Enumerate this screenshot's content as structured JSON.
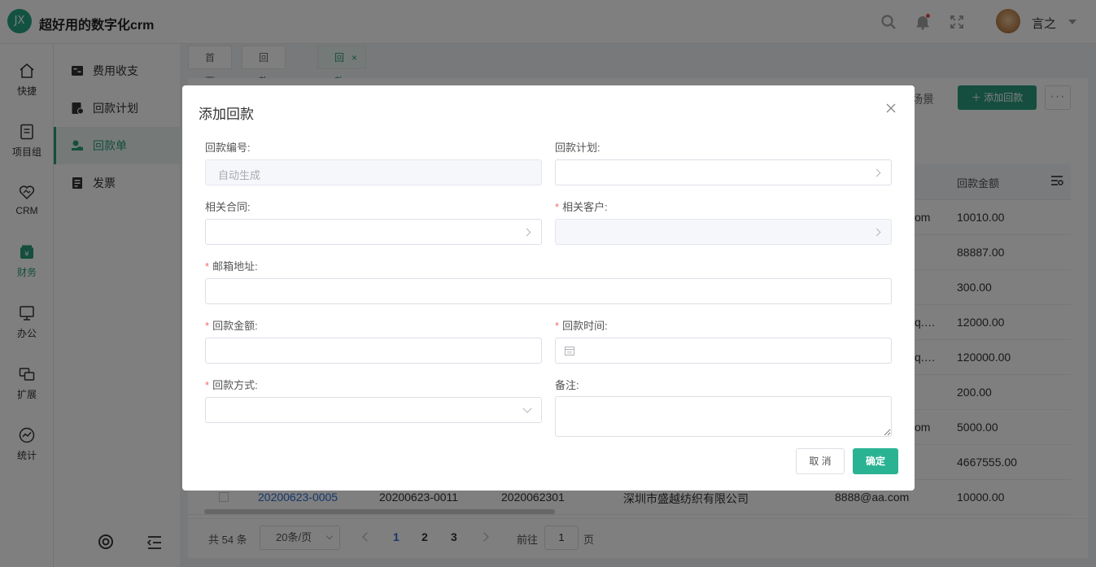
{
  "app": {
    "logo_text": "JX",
    "title": "超好用的数字化crm",
    "user_name": "言之"
  },
  "rail": {
    "items": [
      {
        "label": "快捷",
        "icon": "home-icon"
      },
      {
        "label": "项目组",
        "icon": "document-icon"
      },
      {
        "label": "CRM",
        "icon": "handshake-icon"
      },
      {
        "label": "财务",
        "icon": "finance-icon",
        "active": true
      },
      {
        "label": "办公",
        "icon": "monitor-icon"
      },
      {
        "label": "扩展",
        "icon": "extend-icon"
      },
      {
        "label": "统计",
        "icon": "chart-icon"
      }
    ]
  },
  "sidebar": {
    "items": [
      {
        "label": "费用收支",
        "icon": "expense-icon"
      },
      {
        "label": "回款计划",
        "icon": "plan-icon"
      },
      {
        "label": "回款单",
        "icon": "receipt-icon",
        "active": true
      },
      {
        "label": "发票",
        "icon": "invoice-icon"
      }
    ]
  },
  "tabs": [
    {
      "label": "首页"
    },
    {
      "label": "回款计划"
    },
    {
      "label": "回款单",
      "active": true
    }
  ],
  "toolbar": {
    "scene_label": "场景",
    "add_label": "添加回款",
    "more_label": "···"
  },
  "table": {
    "columns": [
      "回款金额"
    ],
    "rows": [
      {
        "fragment": "om",
        "amount": "10010.00"
      },
      {
        "fragment": "",
        "amount": "88887.00"
      },
      {
        "fragment": "",
        "amount": "300.00"
      },
      {
        "fragment": "q.…",
        "amount": "12000.00"
      },
      {
        "fragment": "q.…",
        "amount": "120000.00"
      },
      {
        "fragment": "",
        "amount": "200.00"
      },
      {
        "fragment": "om",
        "amount": "5000.00"
      },
      {
        "fragment": "",
        "amount": "4667555.00"
      }
    ],
    "last_row": {
      "number": "20200623-0005",
      "plan": "20200623-0011",
      "contract": "2020062301",
      "customer": "深圳市盛越纺织有限公司",
      "email": "8888@aa.com",
      "amount": "10000.00"
    }
  },
  "pager": {
    "total": "共 54 条",
    "page_size": "20条/页",
    "pages": [
      "1",
      "2",
      "3"
    ],
    "current": "1",
    "goto_label": "前往",
    "goto_value": "1",
    "goto_unit": "页"
  },
  "dialog": {
    "title": "添加回款",
    "fields": {
      "number": {
        "label": "回款编号:",
        "placeholder": "自动生成"
      },
      "plan": {
        "label": "回款计划:"
      },
      "contract": {
        "label": "相关合同:"
      },
      "customer": {
        "label": "相关客户:",
        "required": true
      },
      "email": {
        "label": "邮箱地址:",
        "required": true
      },
      "amount": {
        "label": "回款金额:",
        "required": true
      },
      "time": {
        "label": "回款时间:",
        "required": true
      },
      "method": {
        "label": "回款方式:",
        "required": true
      },
      "remark": {
        "label": "备注:"
      }
    },
    "required_mark": "*",
    "cancel_label": "取 消",
    "ok_label": "确定"
  }
}
